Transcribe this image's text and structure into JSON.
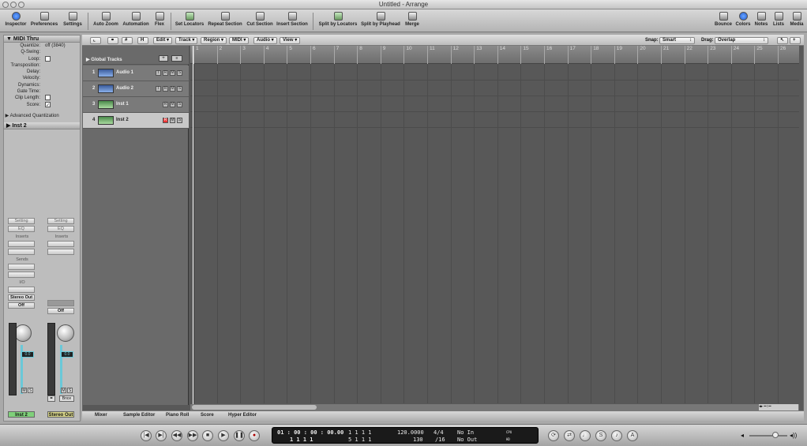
{
  "window": {
    "title": "Untitled - Arrange"
  },
  "toolbar": {
    "left": [
      "Inspector",
      "Preferences",
      "Settings"
    ],
    "mid": [
      "Auto Zoom",
      "Automation",
      "Flex",
      "Set Locators",
      "Repeat Section",
      "Cut Section",
      "Insert Section",
      "Split by Locators",
      "Split by Playhead",
      "Merge"
    ],
    "right": [
      "Bounce",
      "Colors",
      "Notes",
      "Lists",
      "Media"
    ]
  },
  "inspector": {
    "header": "MIDI Thru",
    "rows": [
      {
        "k": "Quantize:",
        "v": "off (3840)"
      },
      {
        "k": "Q-Swing:",
        "v": ""
      },
      {
        "k": "Loop:",
        "v": ""
      },
      {
        "k": "Transposition:",
        "v": ""
      },
      {
        "k": "Delay:",
        "v": ""
      },
      {
        "k": "Velocity:",
        "v": ""
      },
      {
        "k": "Dynamics:",
        "v": ""
      },
      {
        "k": "Gate Time:",
        "v": ""
      },
      {
        "k": "Clip Length:",
        "v": ""
      },
      {
        "k": "Score:",
        "v": ""
      }
    ],
    "advanced": "Advanced Quantization",
    "track_header": "Inst 2",
    "strips": [
      {
        "setting": "Setting",
        "eq": "EQ",
        "inserts": "Inserts",
        "sends": "Sends",
        "io": "I/O",
        "out": "Stereo Out",
        "auto": "Off",
        "level": "0.0",
        "m": "M",
        "s": "S",
        "name": "Inst 2",
        "color": "#7fd07a"
      },
      {
        "setting": "Setting",
        "eq": "EQ",
        "inserts": "Inserts",
        "sends": "",
        "io": "",
        "out": "",
        "auto": "Off",
        "level": "0.0",
        "m": "M",
        "s": "S",
        "bnce": "Bnce",
        "name": "Stereo Out",
        "color": "#d8d58a"
      }
    ]
  },
  "localbar": {
    "menus": [
      "Edit",
      "Track",
      "Region",
      "MIDI",
      "Audio",
      "View"
    ],
    "snap_label": "Snap:",
    "snap_value": "Smart",
    "drag_label": "Drag:",
    "drag_value": "Overlap"
  },
  "global_tracks": "Global Tracks",
  "tracks": [
    {
      "num": "1",
      "name": "Audio 1",
      "type": "audio",
      "buttons": [
        "I",
        "R",
        "M",
        "S"
      ]
    },
    {
      "num": "2",
      "name": "Audio 2",
      "type": "audio",
      "buttons": [
        "I",
        "R",
        "M",
        "S"
      ]
    },
    {
      "num": "3",
      "name": "Inst 1",
      "type": "inst",
      "buttons": [
        "R",
        "M",
        "S"
      ]
    },
    {
      "num": "4",
      "name": "Inst 2",
      "type": "inst",
      "buttons": [
        "R",
        "M",
        "S"
      ],
      "selected": true
    }
  ],
  "ruler": {
    "bars": [
      "1",
      "2",
      "3",
      "4",
      "5",
      "6",
      "7",
      "8",
      "9",
      "10",
      "11",
      "12",
      "13",
      "14",
      "15",
      "16",
      "17",
      "18",
      "19",
      "20",
      "21",
      "22",
      "23",
      "24",
      "25",
      "26"
    ]
  },
  "editor_tabs": [
    "Mixer",
    "Sample Editor",
    "Piano Roll",
    "Score",
    "Hyper Editor"
  ],
  "transport": {
    "buttons": [
      "|◀",
      "▶|",
      "◀◀",
      "▶▶",
      "■",
      "▶",
      "❚❚",
      "●"
    ],
    "smpte": "01 : 00 : 00 : 00.00",
    "bars": "1   1   1   1",
    "position_top": "1   1   1   1",
    "position_bottom": "5   1   1   1",
    "tempo": "120.0000",
    "bpm": "130",
    "sig": "4/4",
    "div": "/16",
    "midi_in": "No In",
    "midi_out": "No Out",
    "cpu": "CPU",
    "hd": "HD"
  }
}
